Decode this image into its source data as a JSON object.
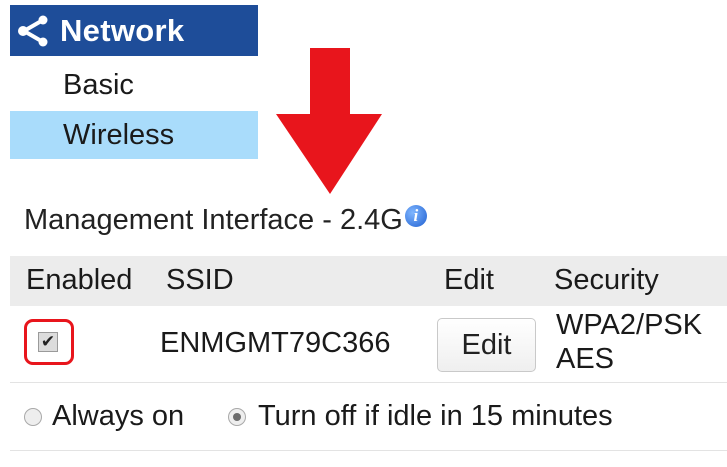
{
  "nav": {
    "header_label": "Network",
    "header_icon": "share-icon",
    "items": [
      {
        "label": "Basic",
        "selected": false
      },
      {
        "label": "Wireless",
        "selected": true
      }
    ]
  },
  "section": {
    "title": "Management Interface - 2.4G",
    "info_icon": "info-icon"
  },
  "table": {
    "headers": {
      "enabled": "Enabled",
      "ssid": "SSID",
      "edit": "Edit",
      "security": "Security"
    },
    "rows": [
      {
        "enabled": true,
        "ssid": "ENMGMT79C366",
        "edit_label": "Edit",
        "security_line1": "WPA2/PSK",
        "security_line2": "AES"
      }
    ]
  },
  "idle": {
    "always_on_label": "Always on",
    "turn_off_label": "Turn off if idle in 15 minutes",
    "selected": "turn_off"
  },
  "colors": {
    "nav_header_bg": "#1e4d99",
    "nav_selected_bg": "#a9dcfb",
    "highlight_red": "#e8151c"
  }
}
